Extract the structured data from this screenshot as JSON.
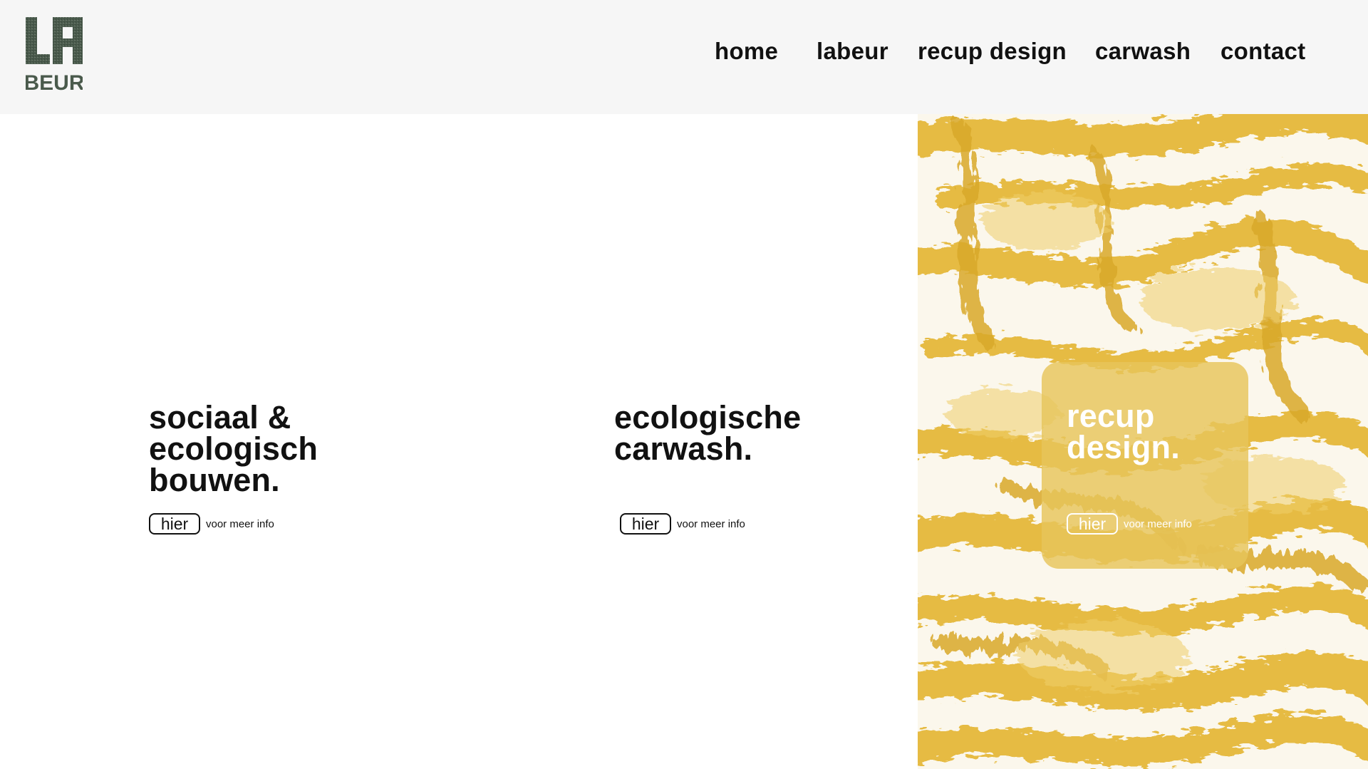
{
  "brand": {
    "logo_line1": "LA",
    "logo_line2": "BEUR",
    "logo_color": "#4a5a4c"
  },
  "nav": {
    "items": [
      {
        "label": "home"
      },
      {
        "label": "labeur"
      },
      {
        "label": "recup design"
      },
      {
        "label": "carwash"
      },
      {
        "label": "contact"
      }
    ]
  },
  "sections": [
    {
      "title": "sociaal &\necologisch\nbouwen.",
      "button": "hier",
      "more": "voor meer info"
    },
    {
      "title": "ecologische\ncarwash.",
      "button": "hier",
      "more": "voor meer info"
    },
    {
      "title": "recup\ndesign.",
      "button": "hier",
      "more": "voor meer info"
    }
  ],
  "colors": {
    "header_bg": "#f6f6f6",
    "paint_yellow": "#e6b93a",
    "text": "#111111"
  }
}
